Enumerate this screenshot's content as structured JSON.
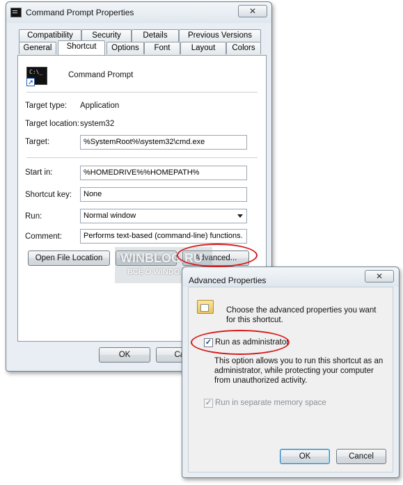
{
  "main_dialog": {
    "title": "Command Prompt Properties",
    "close_glyph": "✕",
    "tabs_row1": [
      "Compatibility",
      "Security",
      "Details",
      "Previous Versions"
    ],
    "tabs_row2": [
      "General",
      "Shortcut",
      "Options",
      "Font",
      "Layout",
      "Colors"
    ],
    "active_tab": "Shortcut",
    "shortcut_name": "Command Prompt",
    "icon_text": "C:\\_",
    "target_type_label": "Target type:",
    "target_type_value": "Application",
    "target_location_label": "Target location:",
    "target_location_value": "system32",
    "target_label": "Target:",
    "target_value": "%SystemRoot%\\system32\\cmd.exe",
    "start_in_label": "Start in:",
    "start_in_value": "%HOMEDRIVE%%HOMEPATH%",
    "shortcut_key_label": "Shortcut key:",
    "shortcut_key_value": "None",
    "run_label": "Run:",
    "run_value": "Normal window",
    "comment_label": "Comment:",
    "comment_value": "Performs text-based (command-line) functions.",
    "open_file_location_button": "Open File Location",
    "change_icon_button": "Change Icon...",
    "advanced_button": "Advanced...",
    "ok_button": "OK",
    "cancel_button_partial": "Can"
  },
  "watermark": {
    "main": "WINBLOG.RU",
    "sub": "ВСЁ О WINDOWS"
  },
  "advanced_dialog": {
    "title": "Advanced Properties",
    "close_glyph": "✕",
    "prompt": "Choose the advanced properties you want for this shortcut.",
    "run_as_admin_label": "Run as administrator",
    "run_as_admin_checked": true,
    "description": "This option allows you to run this shortcut as an administrator, while protecting your computer from unauthorized activity.",
    "separate_memory_label": "Run in separate memory space",
    "separate_memory_checked": true,
    "check_glyph": "✓",
    "ok_button": "OK",
    "cancel_button": "Cancel"
  },
  "colors": {
    "highlight_oval": "#d41a1a",
    "panel_bg": "#ffffff",
    "window_frame": "#e8eef3"
  }
}
